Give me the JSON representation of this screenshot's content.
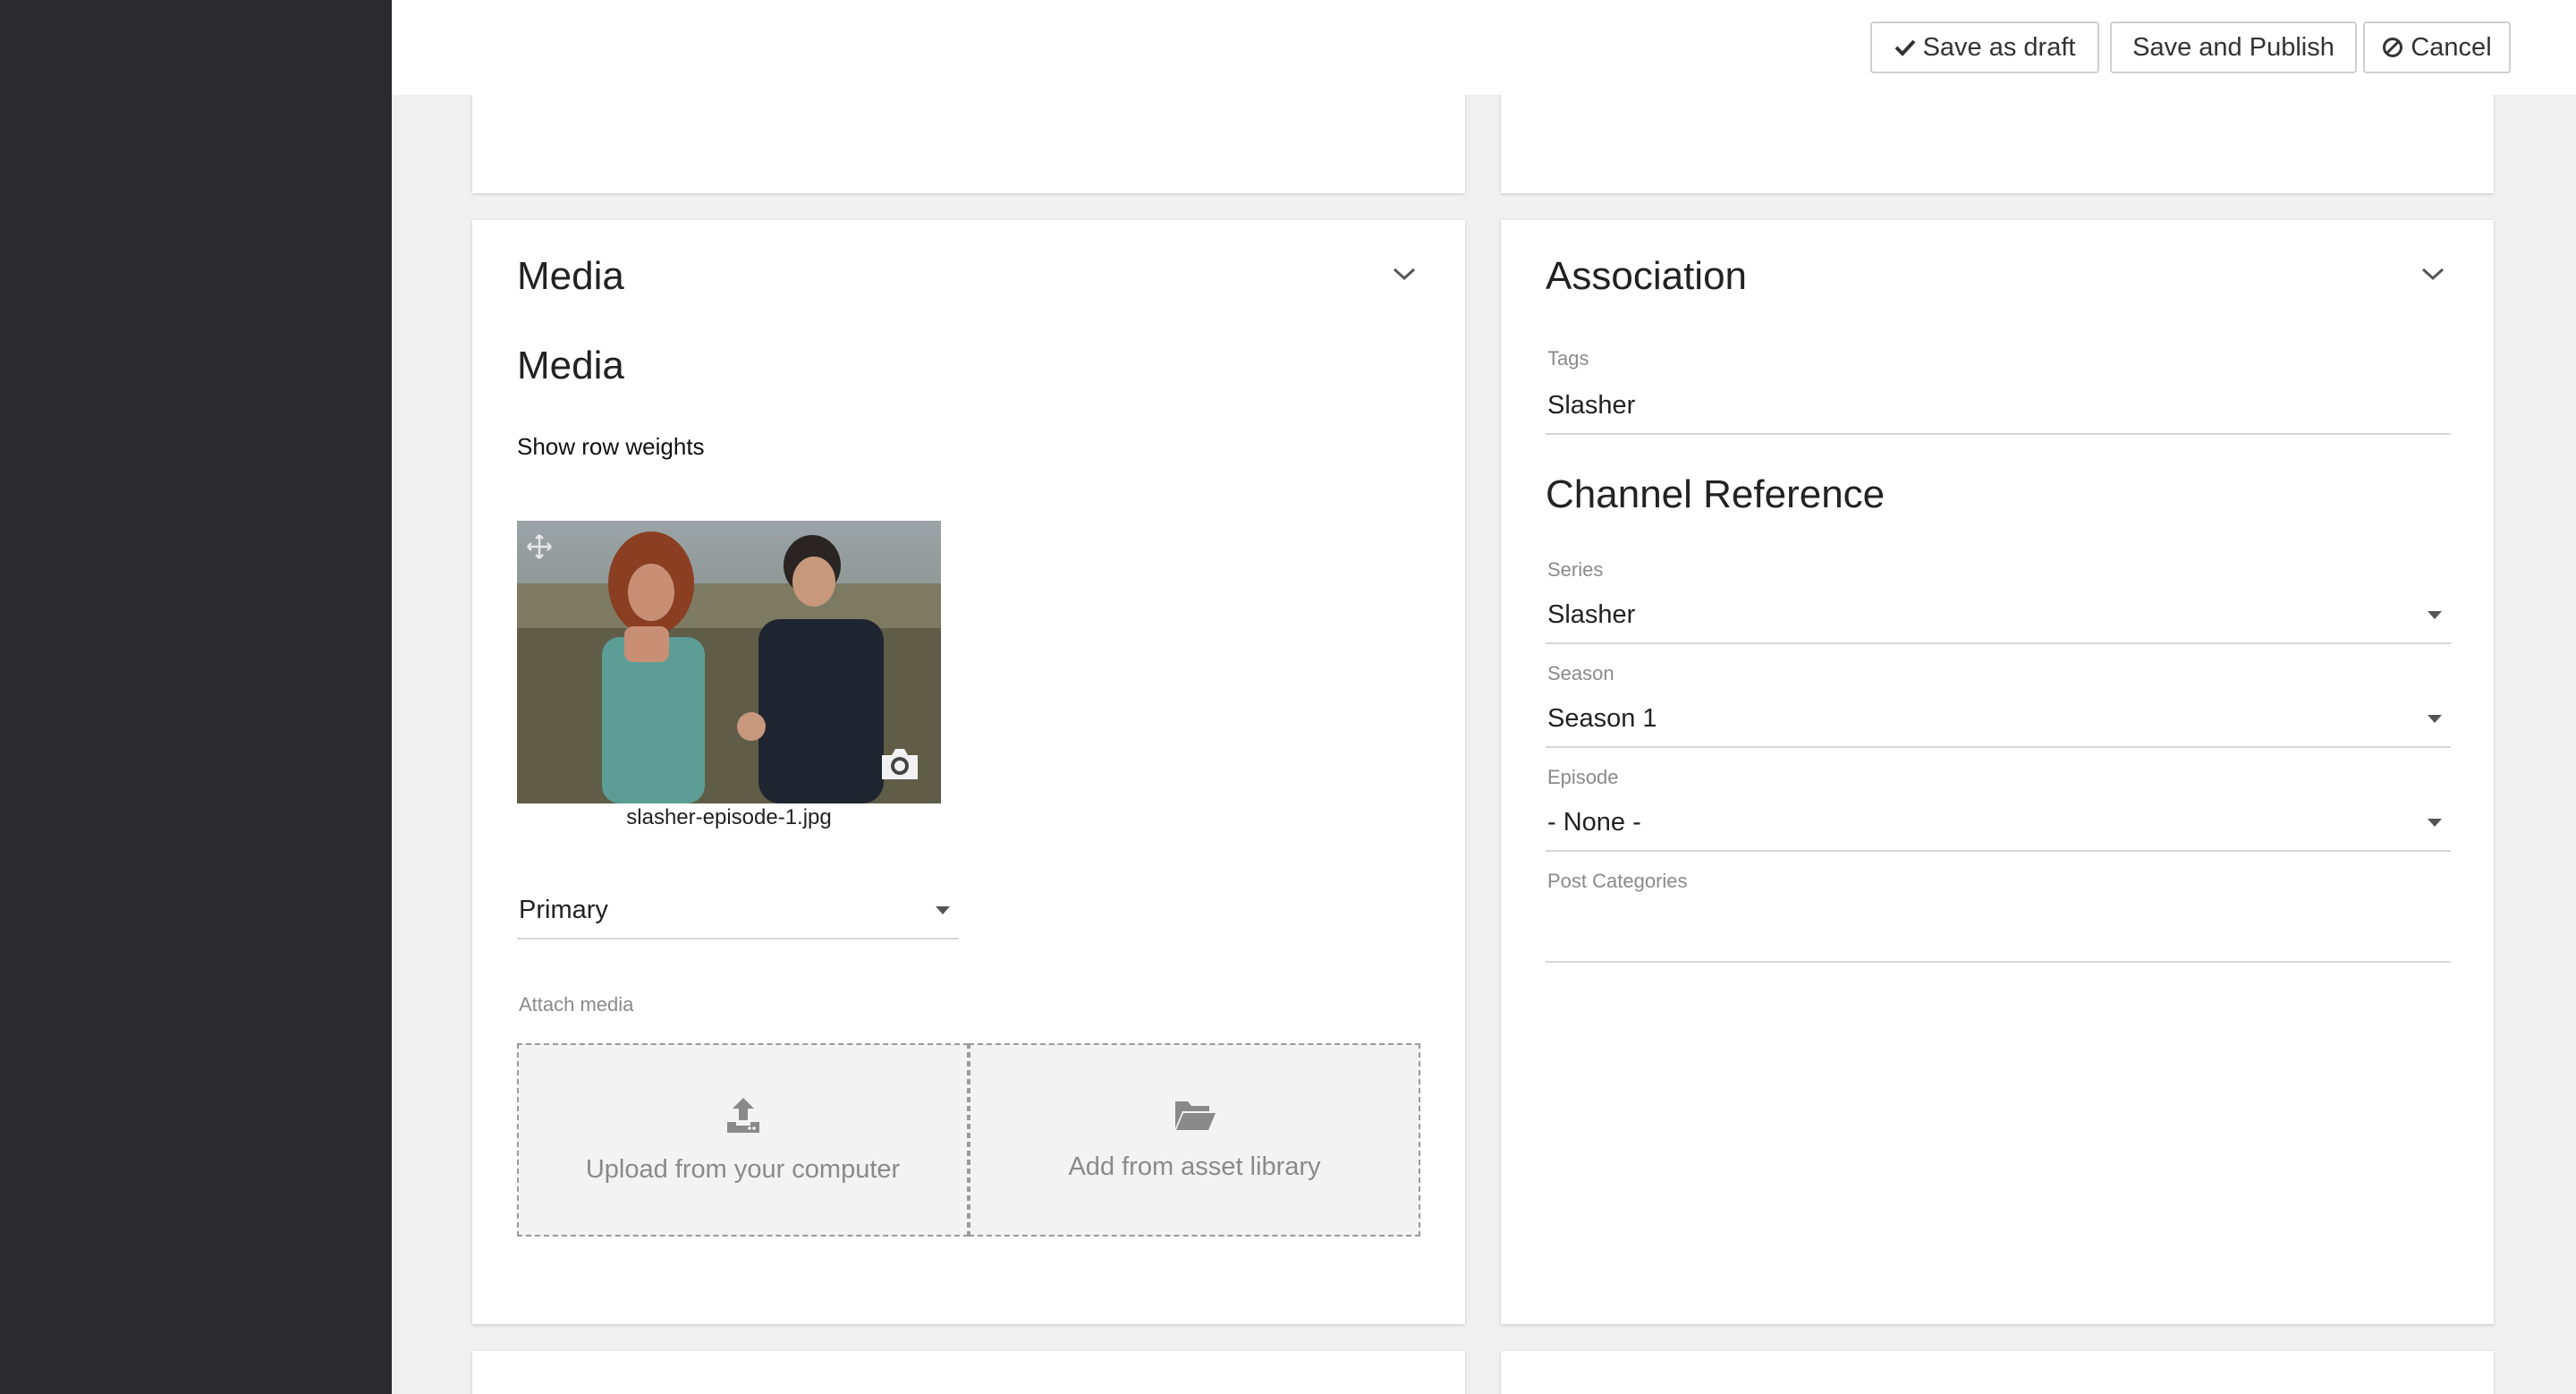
{
  "toolbar": {
    "save_draft_label": "Save as draft",
    "save_publish_label": "Save and Publish",
    "cancel_label": "Cancel"
  },
  "media_panel": {
    "title": "Media",
    "subtitle": "Media",
    "row_weights_label": "Show row weights",
    "image": {
      "filename": "slasher-episode-1.jpg"
    },
    "role_select": {
      "value": "Primary"
    },
    "attach_label": "Attach media",
    "upload_label": "Upload from your computer",
    "library_label": "Add from asset library"
  },
  "association_panel": {
    "title": "Association",
    "tags": {
      "label": "Tags",
      "value": "Slasher"
    },
    "channel_reference_title": "Channel Reference",
    "series": {
      "label": "Series",
      "value": "Slasher"
    },
    "season": {
      "label": "Season",
      "value": "Season 1"
    },
    "episode": {
      "label": "Episode",
      "value": "- None -"
    },
    "post_categories": {
      "label": "Post Categories",
      "value": ""
    }
  },
  "colors": {
    "sidebar": "#2b2b2d",
    "page_background": "#f0f0f0",
    "card_background": "#ffffff",
    "muted_text": "#8a8a8a",
    "border": "#d6d6d6"
  }
}
